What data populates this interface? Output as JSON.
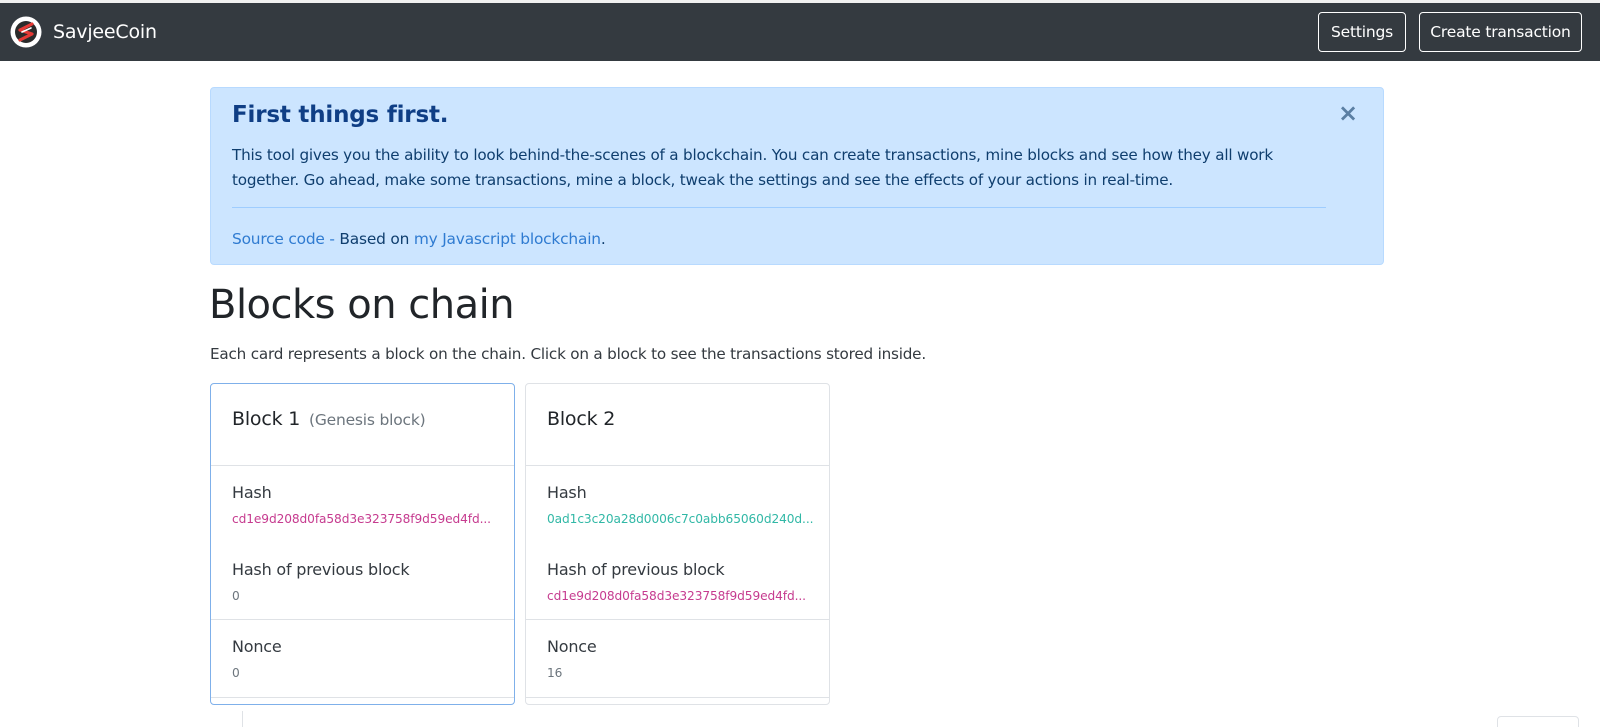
{
  "navbar": {
    "brand": "SavjeeCoin",
    "logo_icon": "savjeecoin-logo-icon",
    "settings_label": "Settings",
    "create_transaction_label": "Create transaction",
    "background": "#343a40"
  },
  "alert": {
    "heading": "First things first.",
    "close_symbol": "×",
    "text": "This tool gives you the ability to look behind-the-scenes of a blockchain. You can create transactions, mine blocks and see how they all work together. Go ahead, make some transactions, mine a block, tweak the settings and see the effects of your actions in real-time.",
    "source_link": "Source code",
    "separator": " - ",
    "based_on": "Based on ",
    "js_link": "my Javascript blockchain",
    "end_punct": ".",
    "background": "#cce5ff"
  },
  "main": {
    "title": "Blocks on chain",
    "subtitle": "Each card represents a block on the chain. Click on a block to see the transactions stored inside."
  },
  "blocks": [
    {
      "title": "Block 1",
      "title_note": "(Genesis block)",
      "hash_label": "Hash",
      "hash": "cd1e9d208d0fa58d3e323758f9d59ed4fd...",
      "prev_label": "Hash of previous block",
      "prev_hash": "0",
      "nonce_label": "Nonce",
      "nonce": "0"
    },
    {
      "title": "Block 2",
      "title_note": "",
      "hash_label": "Hash",
      "hash": "0ad1c3c20a28d0006c7c0abb65060d240d...",
      "prev_label": "Hash of previous block",
      "prev_hash": "cd1e9d208d0fa58d3e323758f9d59ed4fd...",
      "nonce_label": "Nonce",
      "nonce": "16"
    }
  ]
}
